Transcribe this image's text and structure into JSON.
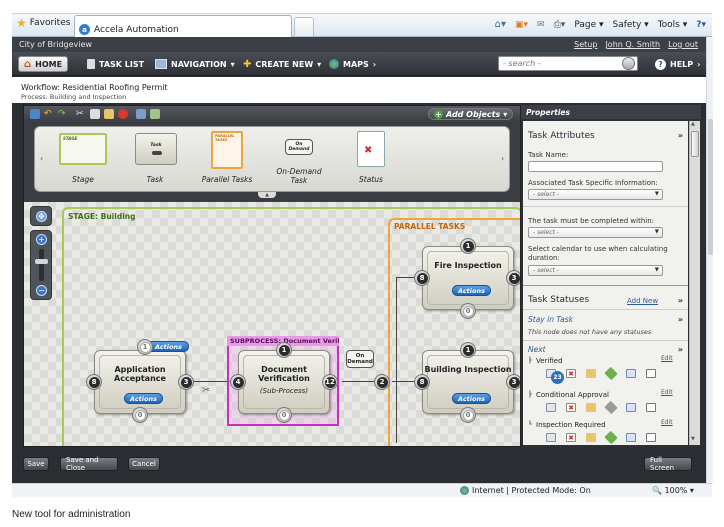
{
  "browser": {
    "favorites_label": "Favorites",
    "tab_title": "Accela Automation",
    "menu": {
      "page": "Page",
      "safety": "Safety",
      "tools": "Tools"
    }
  },
  "app": {
    "city": "City of Bridgeview",
    "links": {
      "setup": "Setup",
      "user": "John Q. Smith",
      "logout": "Log out"
    },
    "nav": {
      "home": "HOME",
      "task_list": "TASK LIST",
      "navigation": "NAVIGATION",
      "create_new": "CREATE NEW",
      "maps": "MAPS",
      "help": "HELP"
    },
    "search_placeholder": "- search -"
  },
  "workflow": {
    "title": "Workflow: Residential Roofing Permit",
    "process": "Process: Building and Inspection"
  },
  "toolbar": {
    "add_objects": "Add Objects"
  },
  "palette": {
    "items": [
      {
        "label": "Stage",
        "thumb_text": "STAGE"
      },
      {
        "label": "Task",
        "thumb_text": "Task"
      },
      {
        "label": "Parallel Tasks",
        "thumb_text": "PARALLEL TASKS"
      },
      {
        "label": "On-Demand Task",
        "thumb_text": "On Demand"
      },
      {
        "label": "Status",
        "thumb_text": ""
      }
    ]
  },
  "canvas": {
    "stage_label": "STAGE: Building",
    "parallel_label": "PARALLEL TASKS",
    "subprocess_label": "SUBPROCESS: Document Verifi...",
    "ondemand_tag": "On Demand",
    "nodes": [
      {
        "title": "Application Acceptance",
        "actions": "Actions",
        "in": "8",
        "out": "3",
        "bottom": "0",
        "top": "1"
      },
      {
        "title": "Document Verification",
        "subtitle": "(Sub-Process)",
        "in": "4",
        "out": "12",
        "bottom": "0",
        "top": "1"
      },
      {
        "title": "Fire Inspection",
        "actions": "Actions",
        "in": "8",
        "out": "3",
        "bottom": "0",
        "top": "1"
      },
      {
        "title": "Building Inspection",
        "actions": "Actions",
        "in": "8",
        "out": "3",
        "bottom": "0",
        "top": "1"
      }
    ],
    "junction": "2"
  },
  "properties": {
    "header": "Properties",
    "task_attributes": "Task Attributes",
    "task_name_label": "Task Name:",
    "assoc_label": "Associated Task Specific Information:",
    "select_placeholder": "- select -",
    "completed_within_label": "The task must be completed within:",
    "calendar_label": "Select calendar to use when calculating duration:",
    "task_statuses": "Task Statuses",
    "add_new": "Add New",
    "stay_in_task": "Stay in Task",
    "no_statuses": "This node does not have any statuses",
    "next": "Next",
    "statuses": [
      {
        "name": "Verified",
        "edit": "Edit",
        "badge": "23"
      },
      {
        "name": "Conditional Approval",
        "edit": "Edit"
      },
      {
        "name": "Inspection Required",
        "edit": "Edit"
      }
    ]
  },
  "buttons": {
    "save": "Save",
    "save_close": "Save and Close",
    "cancel": "Cancel",
    "full_screen": "Full Screen"
  },
  "statusbar": {
    "zone": "Internet | Protected Mode: On",
    "zoom": "100%"
  },
  "caption": "New tool for administration"
}
